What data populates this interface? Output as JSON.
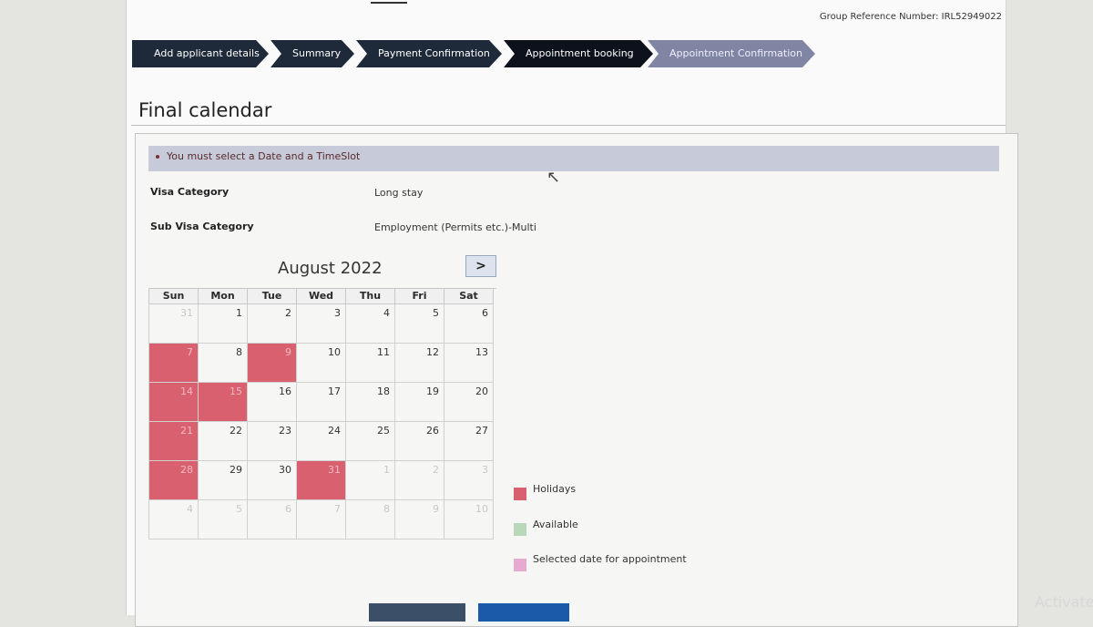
{
  "header": {
    "group_reference": "Group Reference Number: IRL52949022"
  },
  "steps": [
    {
      "label": "Add applicant details",
      "state": "done"
    },
    {
      "label": "Summary",
      "state": "done"
    },
    {
      "label": "Payment Confirmation",
      "state": "done"
    },
    {
      "label": "Appointment booking",
      "state": "active"
    },
    {
      "label": "Appointment Confirmation",
      "state": "pending"
    }
  ],
  "page_title": "Final calendar",
  "alert": {
    "message": "You must select a Date and a TimeSlot"
  },
  "details": {
    "visa_category_label": "Visa Category",
    "visa_category_value": "Long stay",
    "sub_visa_category_label": "Sub Visa Category",
    "sub_visa_category_value": "Employment (Permits etc.)-Multi"
  },
  "calendar": {
    "month_label": "August 2022",
    "next_label": ">",
    "weekdays": [
      "Sun",
      "Mon",
      "Tue",
      "Wed",
      "Thu",
      "Fri",
      "Sat"
    ],
    "weeks": [
      [
        {
          "d": "31",
          "t": "other"
        },
        {
          "d": "1"
        },
        {
          "d": "2"
        },
        {
          "d": "3"
        },
        {
          "d": "4"
        },
        {
          "d": "5"
        },
        {
          "d": "6"
        }
      ],
      [
        {
          "d": "7",
          "t": "holiday"
        },
        {
          "d": "8"
        },
        {
          "d": "9",
          "t": "holiday"
        },
        {
          "d": "10"
        },
        {
          "d": "11"
        },
        {
          "d": "12"
        },
        {
          "d": "13"
        }
      ],
      [
        {
          "d": "14",
          "t": "holiday"
        },
        {
          "d": "15",
          "t": "holiday"
        },
        {
          "d": "16"
        },
        {
          "d": "17"
        },
        {
          "d": "18"
        },
        {
          "d": "19"
        },
        {
          "d": "20"
        }
      ],
      [
        {
          "d": "21",
          "t": "holiday"
        },
        {
          "d": "22"
        },
        {
          "d": "23"
        },
        {
          "d": "24"
        },
        {
          "d": "25"
        },
        {
          "d": "26"
        },
        {
          "d": "27"
        }
      ],
      [
        {
          "d": "28",
          "t": "holiday"
        },
        {
          "d": "29"
        },
        {
          "d": "30"
        },
        {
          "d": "31",
          "t": "holiday"
        },
        {
          "d": "1",
          "t": "other"
        },
        {
          "d": "2",
          "t": "other"
        },
        {
          "d": "3",
          "t": "other"
        }
      ],
      [
        {
          "d": "4",
          "t": "other"
        },
        {
          "d": "5",
          "t": "other"
        },
        {
          "d": "6",
          "t": "other"
        },
        {
          "d": "7",
          "t": "other"
        },
        {
          "d": "8",
          "t": "other"
        },
        {
          "d": "9",
          "t": "other"
        },
        {
          "d": "10",
          "t": "other"
        }
      ]
    ]
  },
  "legend": [
    {
      "label": "Holidays",
      "color": "#d9616f"
    },
    {
      "label": "Available",
      "color": "#b9d8b9"
    },
    {
      "label": "Selected date for appointment",
      "color": "#e6a9cf"
    }
  ],
  "watermark": "Activate"
}
